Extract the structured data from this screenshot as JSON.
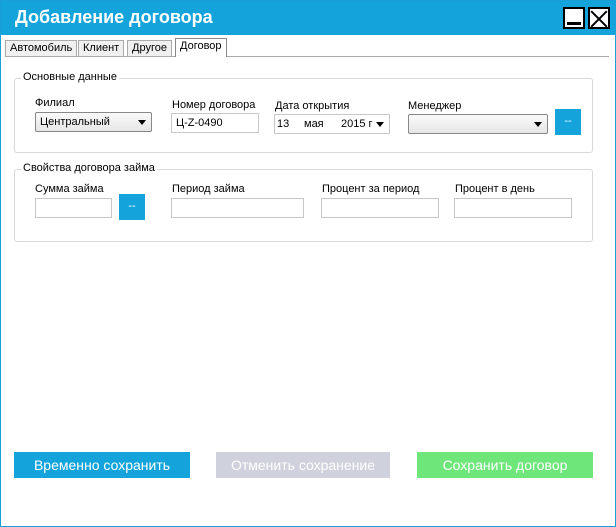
{
  "window": {
    "title": "Добавление договора"
  },
  "tabs": [
    {
      "label": "Автомобиль"
    },
    {
      "label": "Клиент"
    },
    {
      "label": "Другое"
    },
    {
      "label": "Договор"
    }
  ],
  "basic": {
    "title": "Основные данные",
    "branch_label": "Филиал",
    "branch_value": "Центральный",
    "contract_number_label": "Номер договора",
    "contract_number_value": "Ц-Z-0490",
    "open_date_label": "Дата открытия",
    "open_date_day": "13",
    "open_date_month": "мая",
    "open_date_year": "2015 г",
    "manager_label": "Менеджер",
    "manager_value": "",
    "manager_button": "--"
  },
  "loan": {
    "title": "Свойства договора займа",
    "amount_label": "Сумма займа",
    "amount_value": "",
    "amount_button": "--",
    "period_label": "Период займа",
    "period_value": "",
    "rate_period_label": "Процент за период",
    "rate_period_value": "",
    "rate_day_label": "Процент в день",
    "rate_day_value": ""
  },
  "buttons": {
    "temp_save": "Временно сохранить",
    "cancel_save": "Отменить сохранение",
    "save_contract": "Сохранить договор"
  },
  "colors": {
    "accent": "#14a4db",
    "disabled": "#cfd1dc",
    "success": "#6ee67a"
  }
}
